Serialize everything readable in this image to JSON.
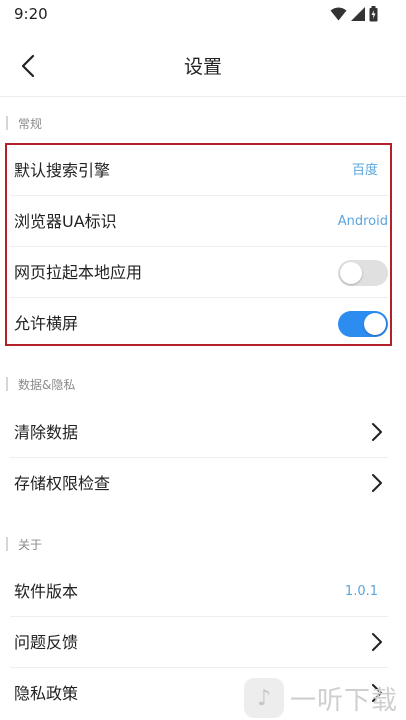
{
  "status_bar": {
    "time": "9:20"
  },
  "header": {
    "title": "设置"
  },
  "sections": {
    "general": {
      "label": "常规",
      "items": [
        {
          "label": "默认搜索引擎",
          "value": "百度"
        },
        {
          "label": "浏览器UA标识",
          "value": "Android"
        },
        {
          "label": "网页拉起本地应用",
          "toggle": "off"
        },
        {
          "label": "允许横屏",
          "toggle": "on"
        }
      ]
    },
    "data_privacy": {
      "label": "数据&隐私",
      "items": [
        {
          "label": "清除数据"
        },
        {
          "label": "存储权限检查"
        }
      ]
    },
    "about": {
      "label": "关于",
      "items": [
        {
          "label": "软件版本",
          "value": "1.0.1"
        },
        {
          "label": "问题反馈"
        },
        {
          "label": "隐私政策"
        }
      ]
    }
  },
  "watermark": {
    "text": "一听下载"
  },
  "colors": {
    "accent": "#2d8cf0",
    "value_text": "#5aa5dc",
    "highlight_border": "#b2202a"
  }
}
